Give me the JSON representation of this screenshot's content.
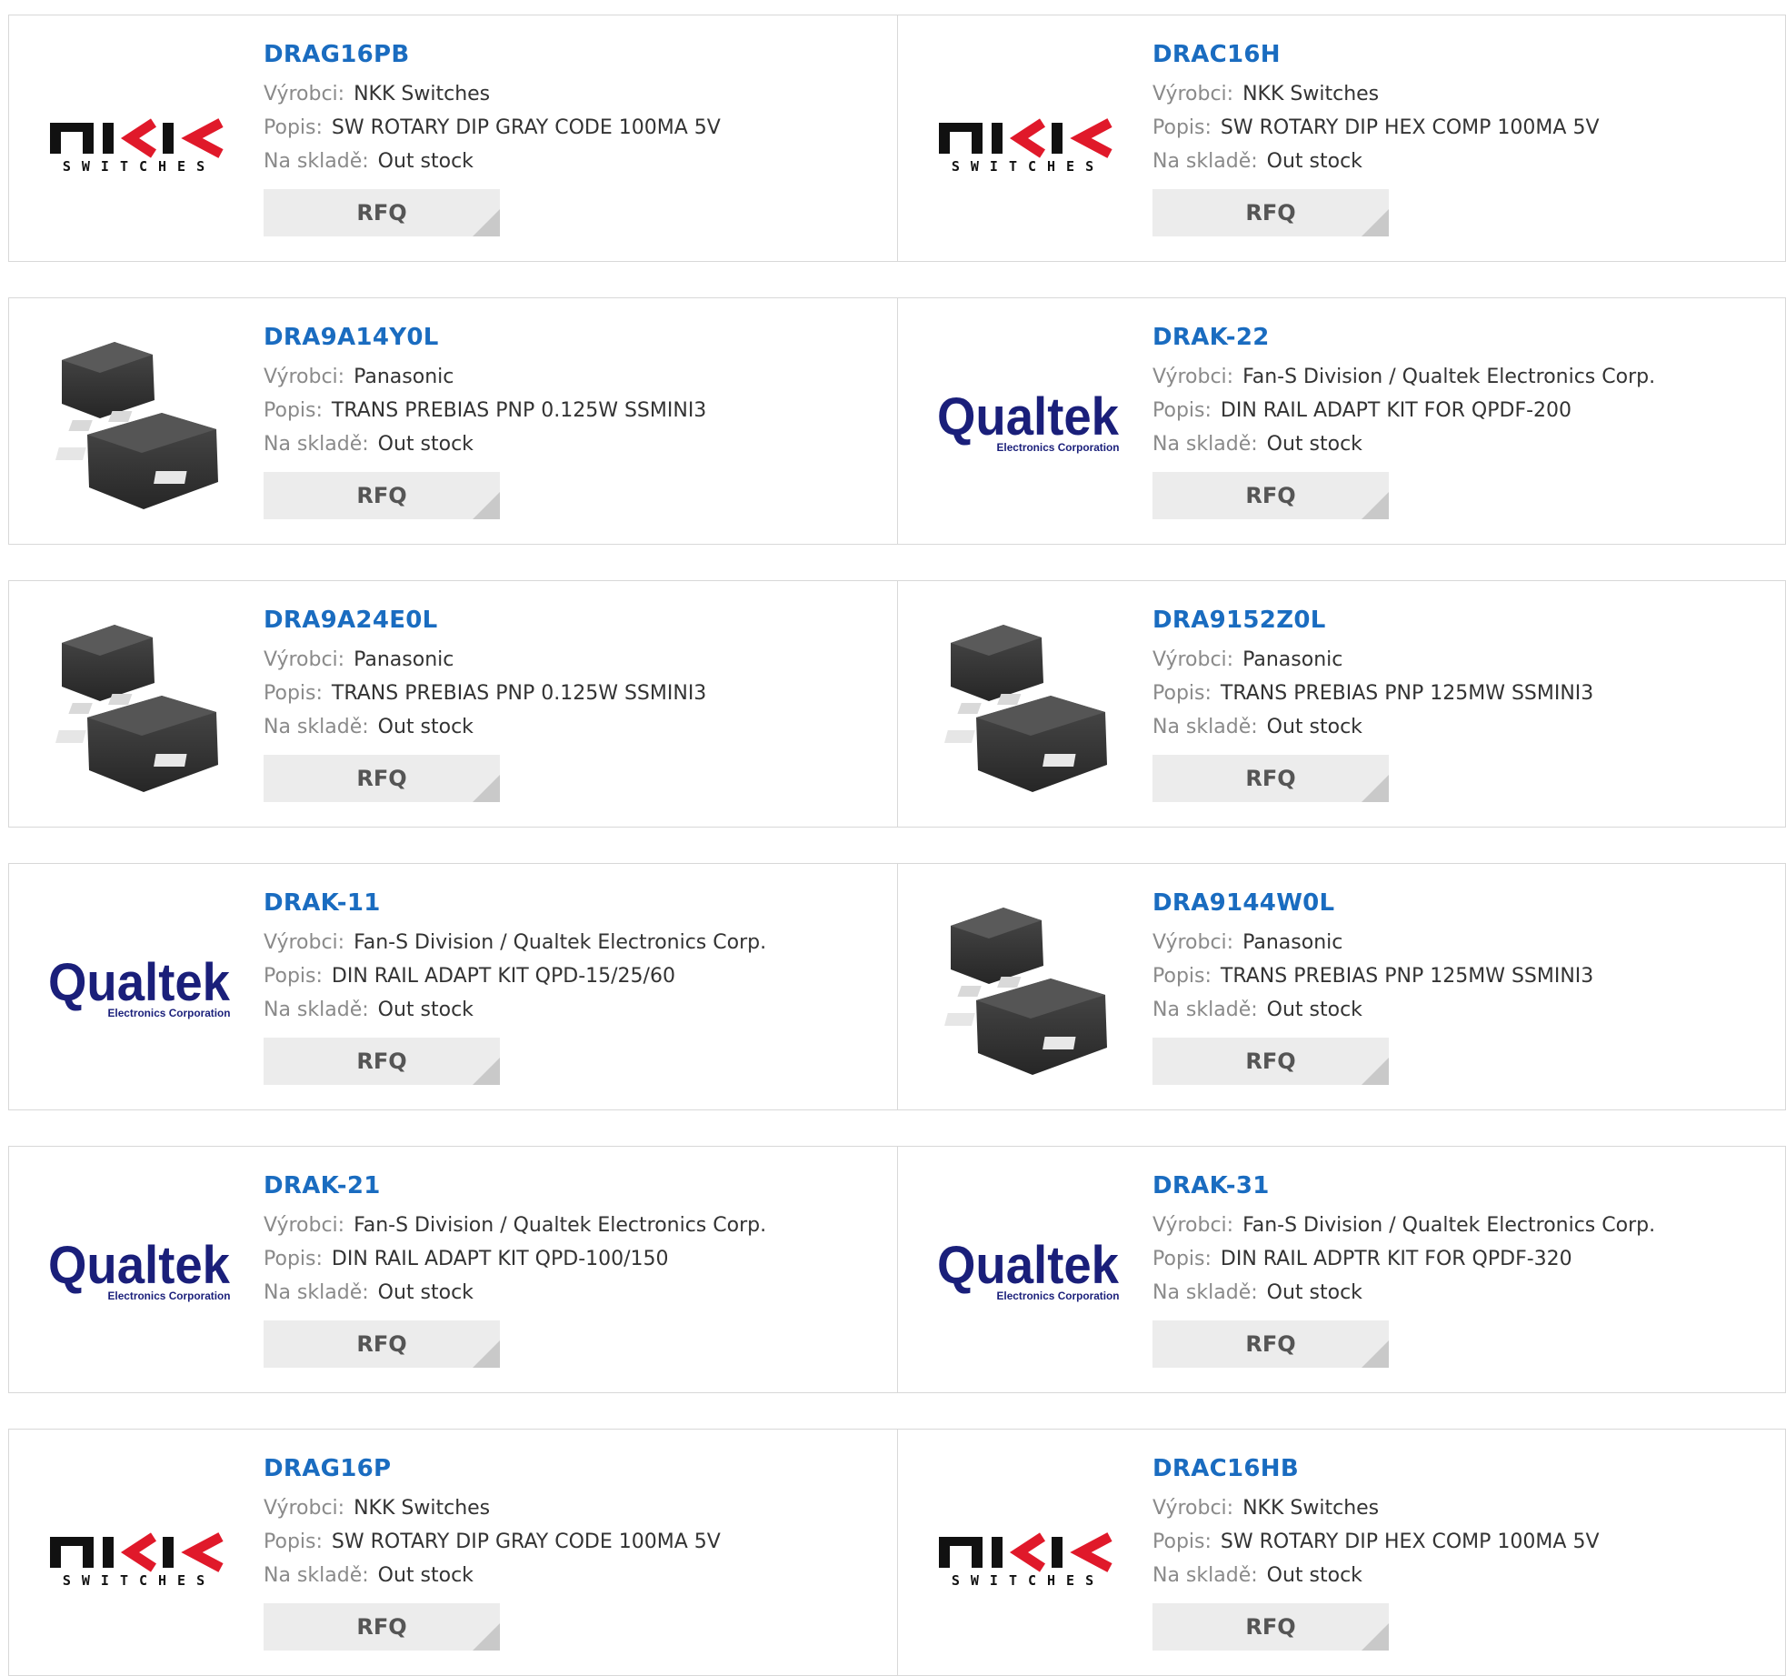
{
  "labels": {
    "manufacturer": "Výrobci:",
    "description": "Popis:",
    "stock": "Na skladě:"
  },
  "button_label": "RFQ",
  "rows": [
    [
      {
        "part": "DRAG16PB",
        "manufacturer": "NKK Switches",
        "description": "SW ROTARY DIP GRAY CODE 100MA 5V",
        "stock": "Out stock",
        "logo": "nkk",
        "logo_text": "SWITCHES"
      },
      {
        "part": "DRAC16H",
        "manufacturer": "NKK Switches",
        "description": "SW ROTARY DIP HEX COMP 100MA 5V",
        "stock": "Out stock",
        "logo": "nkk",
        "logo_text": "SWITCHES"
      }
    ],
    [
      {
        "part": "DRA9A14Y0L",
        "manufacturer": "Panasonic",
        "description": "TRANS PREBIAS PNP 0.125W SSMINI3",
        "stock": "Out stock",
        "logo": "chip"
      },
      {
        "part": "DRAK-22",
        "manufacturer": "Fan-S Division / Qualtek Electronics Corp.",
        "description": "DIN RAIL ADAPT KIT FOR QPDF-200",
        "stock": "Out stock",
        "logo": "qualtek",
        "logo_text": "Qualtek",
        "logo_sub": "Electronics Corporation"
      }
    ],
    [
      {
        "part": "DRA9A24E0L",
        "manufacturer": "Panasonic",
        "description": "TRANS PREBIAS PNP 0.125W SSMINI3",
        "stock": "Out stock",
        "logo": "chip"
      },
      {
        "part": "DRA9152Z0L",
        "manufacturer": "Panasonic",
        "description": "TRANS PREBIAS PNP 125MW SSMINI3",
        "stock": "Out stock",
        "logo": "chip"
      }
    ],
    [
      {
        "part": "DRAK-11",
        "manufacturer": "Fan-S Division / Qualtek Electronics Corp.",
        "description": "DIN RAIL ADAPT KIT QPD-15/25/60",
        "stock": "Out stock",
        "logo": "qualtek",
        "logo_text": "Qualtek",
        "logo_sub": "Electronics Corporation"
      },
      {
        "part": "DRA9144W0L",
        "manufacturer": "Panasonic",
        "description": "TRANS PREBIAS PNP 125MW SSMINI3",
        "stock": "Out stock",
        "logo": "chip"
      }
    ],
    [
      {
        "part": "DRAK-21",
        "manufacturer": "Fan-S Division / Qualtek Electronics Corp.",
        "description": "DIN RAIL ADAPT KIT QPD-100/150",
        "stock": "Out stock",
        "logo": "qualtek",
        "logo_text": "Qualtek",
        "logo_sub": "Electronics Corporation"
      },
      {
        "part": "DRAK-31",
        "manufacturer": "Fan-S Division / Qualtek Electronics Corp.",
        "description": "DIN RAIL ADPTR KIT FOR QPDF-320",
        "stock": "Out stock",
        "logo": "qualtek",
        "logo_text": "Qualtek",
        "logo_sub": "Electronics Corporation"
      }
    ],
    [
      {
        "part": "DRAG16P",
        "manufacturer": "NKK Switches",
        "description": "SW ROTARY DIP GRAY CODE 100MA 5V",
        "stock": "Out stock",
        "logo": "nkk",
        "logo_text": "SWITCHES"
      },
      {
        "part": "DRAC16HB",
        "manufacturer": "NKK Switches",
        "description": "SW ROTARY DIP HEX COMP 100MA 5V",
        "stock": "Out stock",
        "logo": "nkk",
        "logo_text": "SWITCHES"
      }
    ]
  ],
  "colors": {
    "link": "#1a6cc0",
    "button_bg": "#ececec",
    "border": "#d8d8d8",
    "qualtek": "#1a1f7a"
  }
}
